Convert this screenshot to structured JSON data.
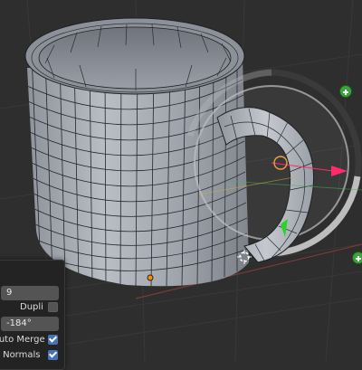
{
  "viewport": {
    "description_icons": [
      "mug-mesh",
      "spin-gizmo",
      "3d-cursor-icon",
      "object-origin-icon"
    ]
  },
  "redo_panel": {
    "steps_value": "9",
    "dupli_label": "Dupli",
    "dupli_checked": false,
    "angle_value": "-184°",
    "auto_merge_label": "Auto Merge",
    "auto_merge_checked": true,
    "flip_normals_label": "lip Normals",
    "flip_normals_checked": true
  },
  "colors": {
    "background": "#2e2e2e",
    "grid": "#383838",
    "mesh": "#a9aeb6",
    "wire": "#1e2024",
    "gizmo_ring": "#b9b9b9",
    "gizmo_green": "#3aa63a",
    "arrow_pink": "#ff2a6a",
    "arrow_green": "#29d429"
  }
}
